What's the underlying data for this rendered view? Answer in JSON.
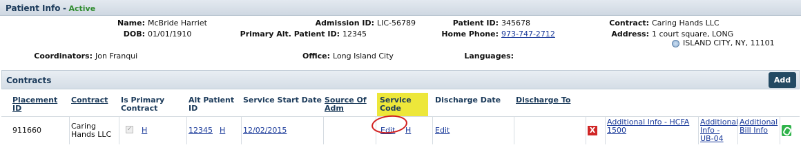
{
  "patient_info": {
    "title": "Patient Info",
    "separator": "-",
    "status": "Active",
    "name_label": "Name:",
    "name_value": "McBride Harriet",
    "admission_label": "Admission ID:",
    "admission_value": "LIC-56789",
    "patient_id_label": "Patient ID:",
    "patient_id_value": "345678",
    "contract_label": "Contract:",
    "contract_value": "Caring Hands LLC",
    "dob_label": "DOB:",
    "dob_value": "01/01/1910",
    "alt_patient_label": "Primary Alt. Patient ID:",
    "alt_patient_value": "12345",
    "home_phone_label": "Home Phone:",
    "home_phone_value": "973-747-2712",
    "address_label": "Address:",
    "address_line1": "1 court square, LONG",
    "address_line2": "ISLAND CITY, NY, 11101",
    "coordinators_label": "Coordinators:",
    "coordinators_value": "Jon Franqui",
    "office_label": "Office:",
    "office_value": "Long Island City",
    "languages_label": "Languages:",
    "languages_value": ""
  },
  "contracts": {
    "title": "Contracts",
    "add_label": "Add",
    "headers": {
      "placement_id_1": "Placement",
      "placement_id_2": "ID",
      "contract": "Contract",
      "is_primary_1": "Is Primary",
      "is_primary_2": "Contract",
      "alt_patient_1": "Alt Patient",
      "alt_patient_2": "ID",
      "service_start": "Service Start Date",
      "source_1": "Source Of",
      "source_2": "Adm",
      "service_code_1": "Service",
      "service_code_2": "Code",
      "discharge_date": "Discharge Date",
      "discharge_to": "Discharge To"
    },
    "row": {
      "placement_id": "911660",
      "contract_1": "Caring",
      "contract_2": "Hands LLC",
      "is_primary_h": "H",
      "alt_patient_id": "12345",
      "alt_patient_h": "H",
      "service_start": "12/02/2015",
      "service_code_edit": "Edit",
      "service_code_h": "H",
      "discharge_edit": "Edit",
      "delete_symbol": "X",
      "addl_hcfa_1": "Additional Info - HCFA",
      "addl_hcfa_2": "1500",
      "addl_ub_1": "Additional",
      "addl_ub_2": "Info -",
      "addl_ub_3": "UB-04",
      "addl_bill_1": "Additional",
      "addl_bill_2": "Bill Info"
    }
  },
  "colors": {
    "status_green": "#2e8b2e",
    "header_navy": "#1b3a5a",
    "add_button": "#234a63",
    "highlight_yellow": "#ede73a",
    "delete_red": "#d02626",
    "attach_green": "#2fb34a",
    "annotation_red": "#d21f1f"
  },
  "icons": {
    "primary_check": "checkbox-checked-disabled-icon",
    "delete": "delete-x-icon",
    "attachment": "paperclip-icon",
    "map": "globe-icon"
  }
}
